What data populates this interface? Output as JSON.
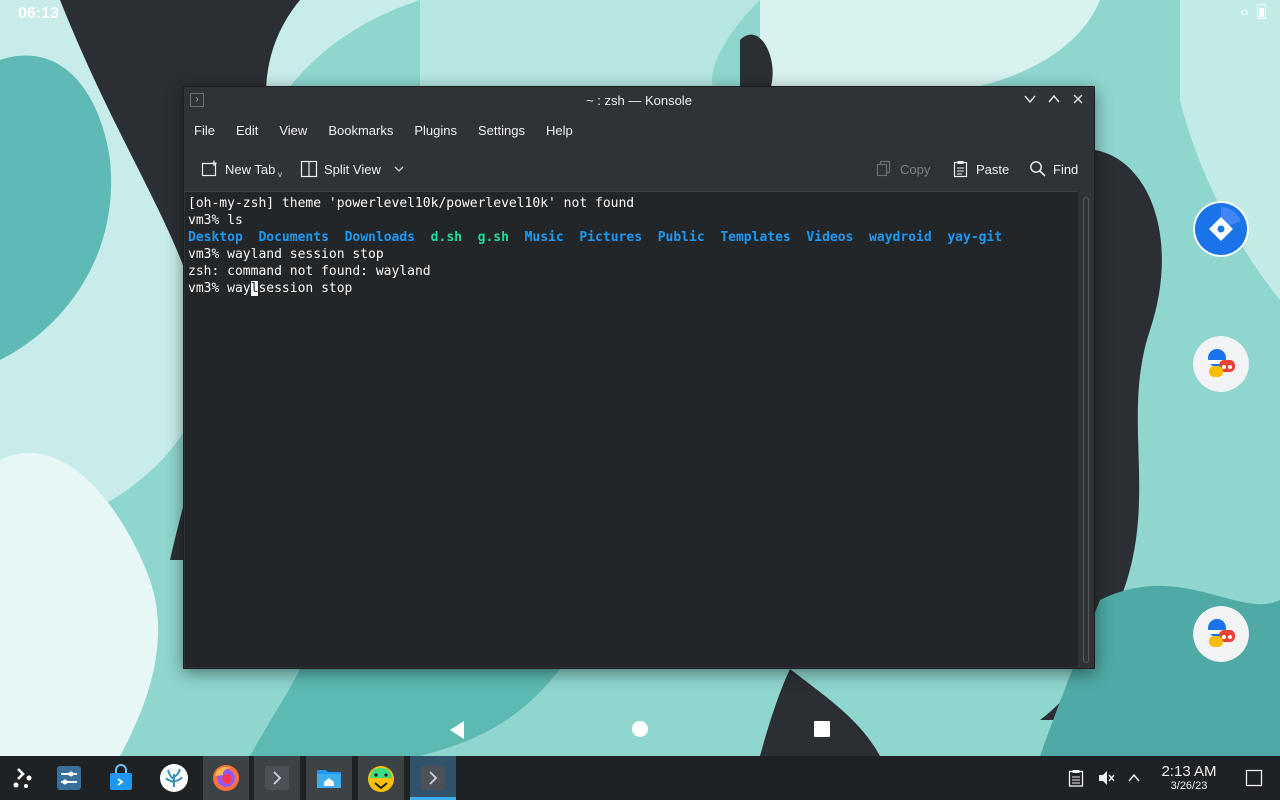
{
  "status_bar": {
    "time": "06:13",
    "signal_glyph": "‹›"
  },
  "window": {
    "title": "~ : zsh — Konsole",
    "menu": [
      "File",
      "Edit",
      "View",
      "Bookmarks",
      "Plugins",
      "Settings",
      "Help"
    ],
    "toolbar": {
      "new_tab": "New Tab",
      "split_view": "Split View",
      "copy": "Copy",
      "paste": "Paste",
      "find": "Find"
    }
  },
  "terminal": {
    "line1": "[oh-my-zsh] theme 'powerlevel10k/powerlevel10k' not found",
    "line2": "vm3% ls",
    "ls_dirs_a": [
      "Desktop",
      "Documents",
      "Downloads"
    ],
    "ls_exe": [
      "d.sh",
      "g.sh"
    ],
    "ls_dirs_b": [
      "Music",
      "Pictures",
      "Public",
      "Templates",
      "Videos",
      "waydroid",
      "yay-git"
    ],
    "line4": "vm3% wayland session stop",
    "line5": "zsh: command not found: wayland",
    "line6_before": "vm3% way",
    "line6_cursor": "l",
    "line6_after": "session stop"
  },
  "taskbar": {
    "clock_time": "2:13 AM",
    "clock_date": "3/26/23"
  },
  "colors": {
    "terminal_bg": "#232629",
    "dir_color": "#1d99f3",
    "exe_color": "#1cdc9a",
    "accent": "#3daee9"
  }
}
